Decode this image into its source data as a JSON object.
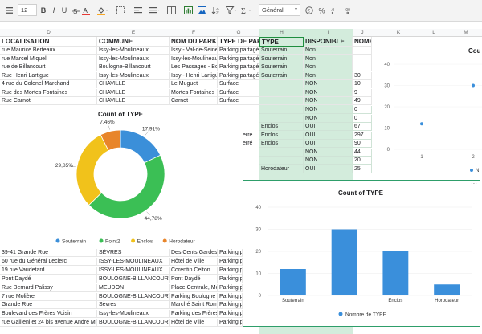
{
  "toolbar": {
    "font_size": "12",
    "bold": "B",
    "italic": "I",
    "underline": "U",
    "number_format": "Général"
  },
  "columns": [
    "D",
    "E",
    "F",
    "G",
    "H",
    "I",
    "J",
    "K",
    "L",
    "M"
  ],
  "headers": {
    "localisation": "LOCALISATION",
    "commune": "COMMUNE",
    "nom": "NOM DU PARKI",
    "type_par": "TYPE DE PAR",
    "type": "TYPE",
    "disponible": "DISPONIBLE",
    "nome": "NOME"
  },
  "rows_top": [
    [
      "rue Maurice Berteaux",
      "Issy-les-Moulineaux",
      "Issy - Val-de-Seine",
      "Parking partagé",
      "Souterrain",
      "Non",
      ""
    ],
    [
      "rue Marcel Miquel",
      "Issy-les-Moulineaux",
      "Issy-les-Moulineaux",
      "Parking partagé",
      "Souterrain",
      "Non",
      ""
    ],
    [
      "rue de Billancourt",
      "Boulogne-Billancourt",
      "Les Passages - Bou",
      "Parking partagé",
      "Souterrain",
      "Non",
      ""
    ],
    [
      "Rue Henri Lartigue",
      "Issy-les-Moulineaux",
      "Issy - Henri Lartigue",
      "Parking partagé",
      "Souterrain",
      "Non",
      "30"
    ],
    [
      "4 rue du Colonel Marchand",
      "CHAVILLE",
      "Le Muguet",
      "Surface",
      "",
      "NON",
      "10"
    ],
    [
      "Rue des Mortes Fontaines",
      "CHAVILLE",
      "Mortes Fontaines",
      "Surface",
      "",
      "NON",
      "9"
    ],
    [
      "Rue Carnot",
      "CHAVILLE",
      "Carnot",
      "Surface",
      "",
      "NON",
      "49"
    ]
  ],
  "rows_mid": [
    [
      "",
      "NON",
      "0"
    ],
    [
      "",
      "NON",
      "0"
    ],
    [
      "Enclos",
      "OUI",
      "67"
    ],
    [
      "Enclos",
      "OUI",
      "297"
    ],
    [
      "Enclos",
      "OUI",
      "90"
    ],
    [
      "",
      "NON",
      "44"
    ],
    [
      "",
      "NON",
      "20"
    ],
    [
      "Horodateur",
      "OUI",
      "25"
    ]
  ],
  "mid_g_text": [
    "",
    "",
    "",
    "erré",
    "erré",
    "",
    ""
  ],
  "rows_bottom": [
    [
      "39-41 Grande Rue",
      "SÈVRES",
      "Des Cents Gardes"
    ],
    [
      "60 rue du Général Leclerc",
      "ISSY-LES-MOULINEAUX",
      "Hôtel de Ville"
    ],
    [
      "19 rue Vaudetard",
      "ISSY-LES-MOULINEAUX",
      "Corentin Celton"
    ],
    [
      "Pont Daydé",
      "BOULOGNE-BILLANCOURT",
      "Pont Daydé"
    ],
    [
      "Rue Bernard Palissy",
      "MEUDON",
      "Place Centrale, Me"
    ],
    [
      "7 rue Molière",
      "BOULOGNE-BILLANCOURT",
      "Parking Boulogne -"
    ],
    [
      "Grande Rue",
      "Sèvres",
      "Marché Saint Roma"
    ],
    [
      "Boulevard des Frères Voisin",
      "Issy-les-Moulineaux",
      "Parking des Frères Voisin"
    ],
    [
      "rue Gallieni et 24 bis avenue André Mor",
      "BOULOGNE-BILLANCOURT",
      "Hôtel de Ville"
    ]
  ],
  "rows_bottom_g": [
    "Parking p",
    "Parking p",
    "Parking p",
    "Parking p",
    "Parking p",
    "Parking p",
    "Parking p",
    "Parking p",
    "Parking p"
  ],
  "pie_chart": {
    "chart_data": {
      "type": "pie",
      "title": "Count of TYPE",
      "categories": [
        "Souterrain",
        "Point2",
        "Enclos",
        "Horodateur"
      ],
      "values": [
        17.91,
        44.78,
        29.85,
        7.46
      ],
      "labels": [
        "17,91%",
        "44,78%",
        "29,85%",
        "7,46%"
      ],
      "colors": [
        "#3b8fd9",
        "#3bbf55",
        "#f1c21b",
        "#e8852a"
      ],
      "legend": "bottom"
    }
  },
  "bar_chart": {
    "chart_data": {
      "type": "bar",
      "title": "Count of TYPE",
      "categories": [
        "Souterrain",
        "",
        "Enclos",
        "Horodateur"
      ],
      "values": [
        12,
        30,
        20,
        5
      ],
      "ylim": [
        0,
        40
      ],
      "yticks": [
        "0",
        "10",
        "20",
        "30",
        "40"
      ],
      "series": [
        {
          "name": "Nombre de TYPE",
          "values": [
            12,
            30,
            20,
            5
          ]
        }
      ],
      "color": "#3a8fdb",
      "legend": "bottom"
    }
  },
  "right_chart": {
    "chart_data": {
      "type": "scatter",
      "title": "Cou",
      "yticks": [
        "0",
        "10",
        "20",
        "30",
        "40"
      ],
      "x": [
        "1",
        "2"
      ],
      "values": [
        12,
        30
      ],
      "legend_label": "N"
    }
  }
}
